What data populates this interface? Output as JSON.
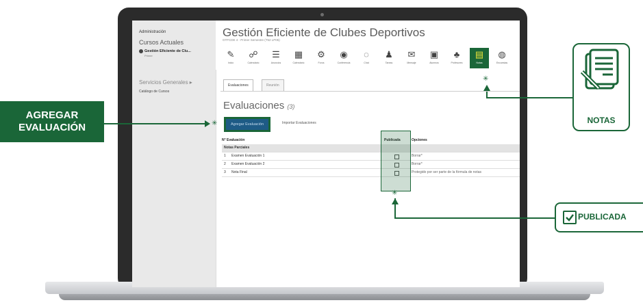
{
  "sidebar": {
    "admin": "Administración",
    "cursos_title": "Cursos Actuales",
    "curso_name": "Gestión Eficiente de Clu...",
    "curso_sub": "Primer",
    "servicios": "Servicios Generales ▸",
    "catalogo": "Catálogo de Cursos"
  },
  "header": {
    "title": "Gestión Eficiente de Clubes Deportivos",
    "subtitle": "GTFCDE 4 - Primer Semestre (T52 LP05)"
  },
  "toolbar": {
    "items": [
      {
        "label": "Inicio",
        "icon": "pencil-icon",
        "glyph": "✎"
      },
      {
        "label": "Calendario",
        "icon": "chat-icon",
        "glyph": "☍"
      },
      {
        "label": "Anuncios",
        "icon": "list-icon",
        "glyph": "☰"
      },
      {
        "label": "Calendario",
        "icon": "calendar-icon",
        "glyph": "▦"
      },
      {
        "label": "Foros",
        "icon": "tools-icon",
        "glyph": "⚙"
      },
      {
        "label": "Conferencia",
        "icon": "settings-icon",
        "glyph": "◉"
      },
      {
        "label": "Chat",
        "icon": "speech-icon",
        "glyph": "◌"
      },
      {
        "label": "Tareas",
        "icon": "person-icon",
        "glyph": "♟"
      },
      {
        "label": "Mensaje",
        "icon": "mail-icon",
        "glyph": "✉"
      },
      {
        "label": "Alumnos",
        "icon": "media-icon",
        "glyph": "▣"
      },
      {
        "label": "Profesores",
        "icon": "users-icon",
        "glyph": "♣"
      },
      {
        "label": "Notas",
        "icon": "notes-icon",
        "glyph": "▤"
      },
      {
        "label": "Encuestas",
        "icon": "grades-icon",
        "glyph": "◍"
      }
    ],
    "active_index": 11
  },
  "tabs": [
    "Evaluaciones",
    "Reunión"
  ],
  "page": {
    "title": "Evaluaciones",
    "count": "(3)",
    "add_button": "Agregar Evaluación",
    "import_link": "Importar Evaluaciones"
  },
  "table": {
    "headers": [
      "N° Evaluación",
      "Publicada",
      "Opciones"
    ],
    "group": "Notas Parciales",
    "rows": [
      {
        "num": "1",
        "name": "Examen Evaluación 1",
        "option": "Borrar*"
      },
      {
        "num": "2",
        "name": "Examen Evaluación 2",
        "option": "Borrar*"
      },
      {
        "num": "3",
        "name": "Nota Final",
        "option": "Protegido por ser parte de la fórmula de notas"
      }
    ]
  },
  "callouts": {
    "agregar": "AGREGAR EVALUACIÓN",
    "notas": "NOTAS",
    "publicada": "PUBLICADA"
  },
  "colors": {
    "brand_green": "#1a6638",
    "button_blue": "#1e5b86"
  }
}
